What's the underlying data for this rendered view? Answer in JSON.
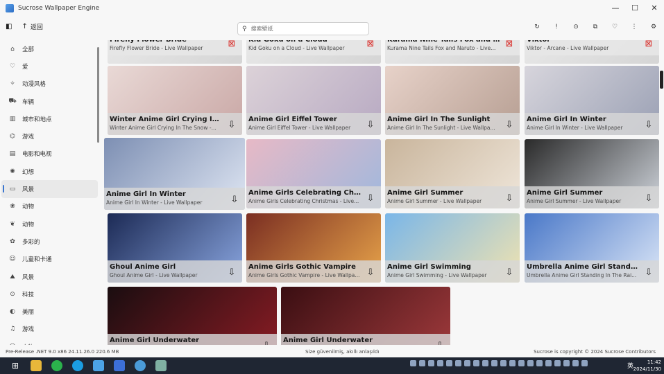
{
  "window": {
    "title": "Sucrose Wallpaper Engine",
    "controls": [
      "—",
      "☐",
      "✕"
    ]
  },
  "toolbar": {
    "back_label": "返回",
    "search_placeholder": "搜索壁纸"
  },
  "sidebar": {
    "items": [
      {
        "label": "全部",
        "icon": "home-icon",
        "glyph": "⌂"
      },
      {
        "label": "爱",
        "icon": "heart-icon",
        "glyph": "♡"
      },
      {
        "label": "动漫风格",
        "icon": "sparkle-icon",
        "glyph": "✧"
      },
      {
        "label": "车辆",
        "icon": "car-icon",
        "glyph": "⛟"
      },
      {
        "label": "城市和地点",
        "icon": "building-icon",
        "glyph": "▥"
      },
      {
        "label": "游戏",
        "icon": "gamepad-icon",
        "glyph": "⌬"
      },
      {
        "label": "电影和电视",
        "icon": "film-icon",
        "glyph": "▤"
      },
      {
        "label": "幻想",
        "icon": "wand-icon",
        "glyph": "✺"
      },
      {
        "label": "风景",
        "icon": "landscape-icon",
        "glyph": "▭",
        "active": true
      },
      {
        "label": "动物",
        "icon": "paw-icon",
        "glyph": "❀"
      },
      {
        "label": "动物",
        "icon": "leaf-icon",
        "glyph": "❦"
      },
      {
        "label": "多彩的",
        "icon": "palette-icon",
        "glyph": "✿"
      },
      {
        "label": "儿童和卡通",
        "icon": "smile-icon",
        "glyph": "☺"
      },
      {
        "label": "风景",
        "icon": "mountain-icon",
        "glyph": "⛰"
      },
      {
        "label": "科技",
        "icon": "chip-icon",
        "glyph": "⊙"
      },
      {
        "label": "美丽",
        "icon": "contrast-icon",
        "glyph": "◐"
      },
      {
        "label": "游戏",
        "icon": "headphones-icon",
        "glyph": "♫"
      },
      {
        "label": "人物",
        "icon": "person-icon",
        "glyph": "☺"
      }
    ]
  },
  "grid": {
    "top_row": [
      {
        "title": "Firefly Flower Bride",
        "subtitle": "Firefly Flower Bride - Live Wallpaper"
      },
      {
        "title": "Kid Goku on a Cloud",
        "subtitle": "Kid Goku on a Cloud - Live Wallpaper"
      },
      {
        "title": "Kurama Nine Tails Fox and Na...",
        "subtitle": "Kurama Nine Tails Fox and Naruto - Live..."
      },
      {
        "title": "Viktor",
        "subtitle": "Viktor - Arcane - Live Wallpaper"
      }
    ],
    "rows": [
      [
        {
          "title": "Winter Anime Girl Crying In T...",
          "subtitle": "Winter Anime Girl Crying In The Snow -..."
        },
        {
          "title": "Anime Girl Eiffel Tower",
          "subtitle": "Anime Girl Eiffel Tower - Live Wallpaper"
        },
        {
          "title": "Anime Girl In The Sunlight",
          "subtitle": "Anime Girl In The Sunlight - Live Wallpa..."
        },
        {
          "title": "Anime Girl In Winter",
          "subtitle": "Anime Girl In Winter - Live Wallpaper"
        }
      ],
      [
        {
          "title": "Anime Girl In Winter",
          "subtitle": "Anime Girl In Winter - Live Wallpaper"
        },
        {
          "title": "Anime Girls Celebrating Christ...",
          "subtitle": "Anime Girls Celebrating Christmas - Live..."
        },
        {
          "title": "Anime Girl Summer",
          "subtitle": "Anime Girl Summer - Live Wallpaper"
        },
        {
          "title": "Anime Girl Summer",
          "subtitle": "Anime Girl Summer - Live Wallpaper"
        }
      ],
      [
        {
          "title": "Ghoul Anime Girl",
          "subtitle": "Ghoul Anime Girl - Live Wallpaper"
        },
        {
          "title": "Anime Girls Gothic Vampire",
          "subtitle": "Anime Girls Gothic Vampire - Live Wallpa..."
        },
        {
          "title": "Anime Girl Swimming",
          "subtitle": "Anime Girl Swimming - Live Wallpaper"
        },
        {
          "title": "Umbrella Anime Girl Standing...",
          "subtitle": "Umbrella Anime Girl Standing In The Rai..."
        }
      ],
      [
        {
          "title": "Anime Girl Underwater",
          "subtitle": ""
        },
        {
          "title": "Anime Girl Underwater",
          "subtitle": ""
        }
      ]
    ]
  },
  "status": {
    "left": "Pre-Release  .NET 9.0  x86  24.11.26.0  220.6 MB",
    "middle": "Size güvenilmiş, akıllı anlaşıldı",
    "right": "Sucrose is copyright © 2024 Sucrose Contributors"
  },
  "taskbar": {
    "ime": "英",
    "time": "11:42",
    "date": "2024/11/30"
  }
}
